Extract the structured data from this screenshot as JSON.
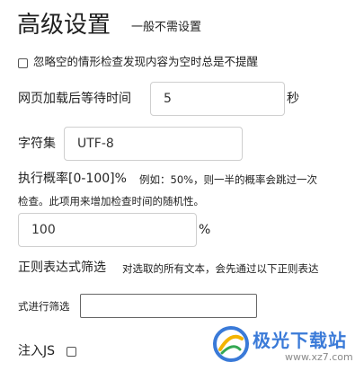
{
  "header": {
    "title": "高级设置",
    "subtitle": "一般不需设置"
  },
  "ignore_empty": {
    "label": "忽略空的情形检查发现内容为空时总是不提醒",
    "checked": false
  },
  "wait_time": {
    "label": "网页加载后等待时间",
    "value": "5",
    "unit": "秒"
  },
  "charset": {
    "label": "字符集",
    "value": "UTF-8"
  },
  "probability": {
    "label": "执行概率[0-100]%",
    "hint_line1": "例如：50%，则一半的概率会跳过一次",
    "hint_line2": "检查。此项用来增加检查时间的随机性。",
    "value": "100",
    "unit": "%"
  },
  "regex": {
    "label": "正则表达式筛选",
    "hint_line1": "对选取的所有文本，会先通过以下正则表达",
    "hint_line2": "式进行筛选",
    "value": ""
  },
  "inject_js": {
    "label": "注入JS",
    "checked": false
  },
  "watermark": {
    "brand": "极光下载站",
    "url": "www.xz7.com"
  }
}
